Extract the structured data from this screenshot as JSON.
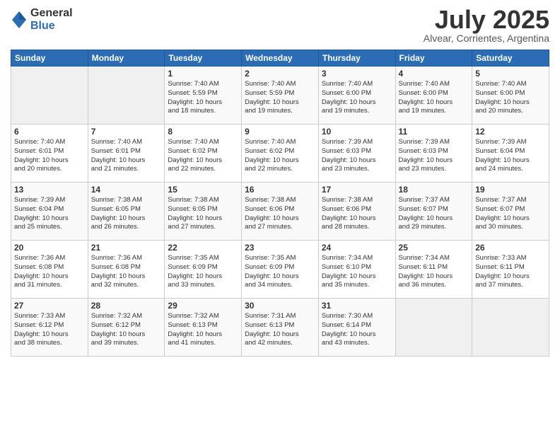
{
  "logo": {
    "general": "General",
    "blue": "Blue"
  },
  "title": "July 2025",
  "subtitle": "Alvear, Corrientes, Argentina",
  "days_header": [
    "Sunday",
    "Monday",
    "Tuesday",
    "Wednesday",
    "Thursday",
    "Friday",
    "Saturday"
  ],
  "weeks": [
    [
      {
        "num": "",
        "info": ""
      },
      {
        "num": "",
        "info": ""
      },
      {
        "num": "1",
        "info": "Sunrise: 7:40 AM\nSunset: 5:59 PM\nDaylight: 10 hours\nand 18 minutes."
      },
      {
        "num": "2",
        "info": "Sunrise: 7:40 AM\nSunset: 5:59 PM\nDaylight: 10 hours\nand 19 minutes."
      },
      {
        "num": "3",
        "info": "Sunrise: 7:40 AM\nSunset: 6:00 PM\nDaylight: 10 hours\nand 19 minutes."
      },
      {
        "num": "4",
        "info": "Sunrise: 7:40 AM\nSunset: 6:00 PM\nDaylight: 10 hours\nand 19 minutes."
      },
      {
        "num": "5",
        "info": "Sunrise: 7:40 AM\nSunset: 6:00 PM\nDaylight: 10 hours\nand 20 minutes."
      }
    ],
    [
      {
        "num": "6",
        "info": "Sunrise: 7:40 AM\nSunset: 6:01 PM\nDaylight: 10 hours\nand 20 minutes."
      },
      {
        "num": "7",
        "info": "Sunrise: 7:40 AM\nSunset: 6:01 PM\nDaylight: 10 hours\nand 21 minutes."
      },
      {
        "num": "8",
        "info": "Sunrise: 7:40 AM\nSunset: 6:02 PM\nDaylight: 10 hours\nand 22 minutes."
      },
      {
        "num": "9",
        "info": "Sunrise: 7:40 AM\nSunset: 6:02 PM\nDaylight: 10 hours\nand 22 minutes."
      },
      {
        "num": "10",
        "info": "Sunrise: 7:39 AM\nSunset: 6:03 PM\nDaylight: 10 hours\nand 23 minutes."
      },
      {
        "num": "11",
        "info": "Sunrise: 7:39 AM\nSunset: 6:03 PM\nDaylight: 10 hours\nand 23 minutes."
      },
      {
        "num": "12",
        "info": "Sunrise: 7:39 AM\nSunset: 6:04 PM\nDaylight: 10 hours\nand 24 minutes."
      }
    ],
    [
      {
        "num": "13",
        "info": "Sunrise: 7:39 AM\nSunset: 6:04 PM\nDaylight: 10 hours\nand 25 minutes."
      },
      {
        "num": "14",
        "info": "Sunrise: 7:38 AM\nSunset: 6:05 PM\nDaylight: 10 hours\nand 26 minutes."
      },
      {
        "num": "15",
        "info": "Sunrise: 7:38 AM\nSunset: 6:05 PM\nDaylight: 10 hours\nand 27 minutes."
      },
      {
        "num": "16",
        "info": "Sunrise: 7:38 AM\nSunset: 6:06 PM\nDaylight: 10 hours\nand 27 minutes."
      },
      {
        "num": "17",
        "info": "Sunrise: 7:38 AM\nSunset: 6:06 PM\nDaylight: 10 hours\nand 28 minutes."
      },
      {
        "num": "18",
        "info": "Sunrise: 7:37 AM\nSunset: 6:07 PM\nDaylight: 10 hours\nand 29 minutes."
      },
      {
        "num": "19",
        "info": "Sunrise: 7:37 AM\nSunset: 6:07 PM\nDaylight: 10 hours\nand 30 minutes."
      }
    ],
    [
      {
        "num": "20",
        "info": "Sunrise: 7:36 AM\nSunset: 6:08 PM\nDaylight: 10 hours\nand 31 minutes."
      },
      {
        "num": "21",
        "info": "Sunrise: 7:36 AM\nSunset: 6:08 PM\nDaylight: 10 hours\nand 32 minutes."
      },
      {
        "num": "22",
        "info": "Sunrise: 7:35 AM\nSunset: 6:09 PM\nDaylight: 10 hours\nand 33 minutes."
      },
      {
        "num": "23",
        "info": "Sunrise: 7:35 AM\nSunset: 6:09 PM\nDaylight: 10 hours\nand 34 minutes."
      },
      {
        "num": "24",
        "info": "Sunrise: 7:34 AM\nSunset: 6:10 PM\nDaylight: 10 hours\nand 35 minutes."
      },
      {
        "num": "25",
        "info": "Sunrise: 7:34 AM\nSunset: 6:11 PM\nDaylight: 10 hours\nand 36 minutes."
      },
      {
        "num": "26",
        "info": "Sunrise: 7:33 AM\nSunset: 6:11 PM\nDaylight: 10 hours\nand 37 minutes."
      }
    ],
    [
      {
        "num": "27",
        "info": "Sunrise: 7:33 AM\nSunset: 6:12 PM\nDaylight: 10 hours\nand 38 minutes."
      },
      {
        "num": "28",
        "info": "Sunrise: 7:32 AM\nSunset: 6:12 PM\nDaylight: 10 hours\nand 39 minutes."
      },
      {
        "num": "29",
        "info": "Sunrise: 7:32 AM\nSunset: 6:13 PM\nDaylight: 10 hours\nand 41 minutes."
      },
      {
        "num": "30",
        "info": "Sunrise: 7:31 AM\nSunset: 6:13 PM\nDaylight: 10 hours\nand 42 minutes."
      },
      {
        "num": "31",
        "info": "Sunrise: 7:30 AM\nSunset: 6:14 PM\nDaylight: 10 hours\nand 43 minutes."
      },
      {
        "num": "",
        "info": ""
      },
      {
        "num": "",
        "info": ""
      }
    ]
  ]
}
